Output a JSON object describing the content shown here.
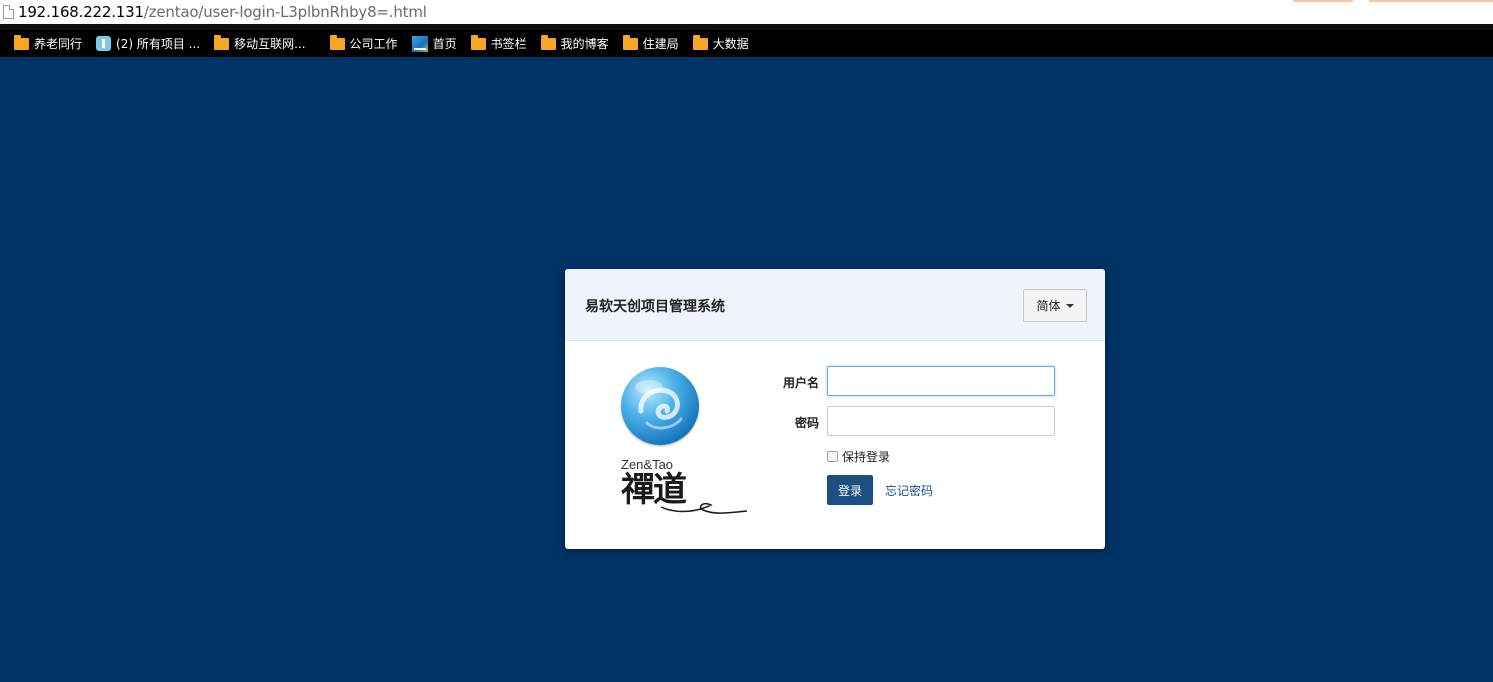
{
  "browser": {
    "url_host": "192.168.222.131",
    "url_path": "/zentao/user-login-L3plbnRhby8=.html"
  },
  "bookmarks": [
    {
      "label": "养老同行",
      "icon": "folder-icon"
    },
    {
      "label": "(2) 所有项目 ...",
      "icon": "tool-icon"
    },
    {
      "label": "移动互联网...",
      "icon": "folder-icon"
    },
    {
      "label": "公司工作",
      "icon": "folder-icon"
    },
    {
      "label": "首页",
      "icon": "ui-icon"
    },
    {
      "label": "书签栏",
      "icon": "folder-icon"
    },
    {
      "label": "我的博客",
      "icon": "folder-icon"
    },
    {
      "label": "住建局",
      "icon": "folder-icon"
    },
    {
      "label": "大数据",
      "icon": "folder-icon"
    }
  ],
  "login": {
    "title": "易软天创项目管理系统",
    "language": "简体",
    "logo_text": "Zen&Tao",
    "logo_mark": "禪道",
    "username_label": "用户名",
    "password_label": "密码",
    "username_value": "",
    "password_value": "",
    "remember_label": "保持登录",
    "submit_label": "登录",
    "forgot_label": "忘记密码"
  },
  "colors": {
    "background": "#003366",
    "header": "#eef3fd",
    "button": "#1e4f82",
    "link": "#1b4b8f"
  }
}
